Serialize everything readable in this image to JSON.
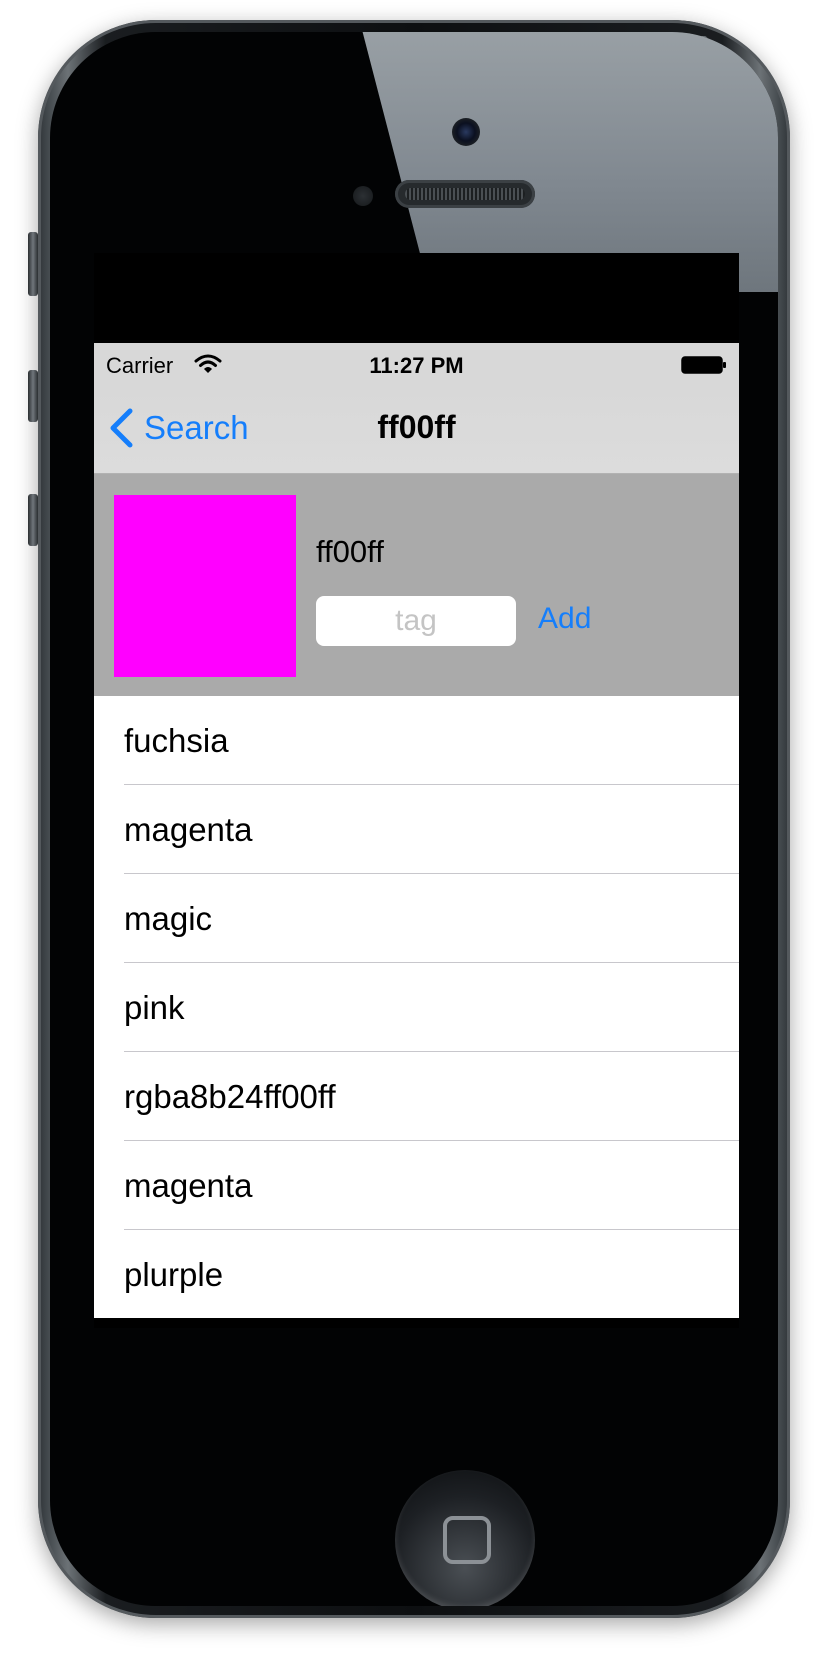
{
  "status_bar": {
    "carrier": "Carrier",
    "time": "11:27 PM",
    "icons": [
      "wifi-icon",
      "battery-icon"
    ]
  },
  "nav": {
    "back_label": "Search",
    "title": "ff00ff"
  },
  "color_header": {
    "swatch_color": "#ff00ff",
    "hex_label": "ff00ff",
    "tag_input_value": "",
    "tag_input_placeholder": "tag",
    "add_label": "Add"
  },
  "tags": [
    {
      "label": "fuchsia"
    },
    {
      "label": "magenta"
    },
    {
      "label": "magic"
    },
    {
      "label": "pink"
    },
    {
      "label": "rgba8b24ff00ff"
    },
    {
      "label": "magenta"
    },
    {
      "label": "plurple"
    }
  ],
  "colors": {
    "accent": "#157efb",
    "header_bg": "#aaaaaa",
    "bar_bg": "#d8d8d8"
  }
}
